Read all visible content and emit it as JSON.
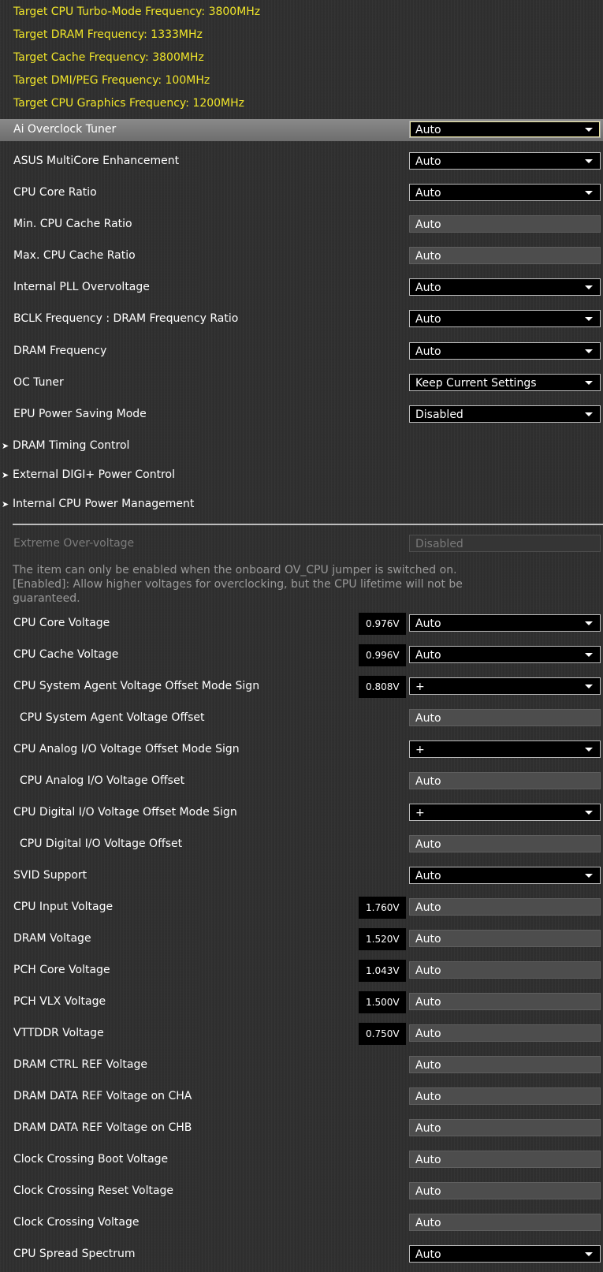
{
  "info_lines": [
    "Target CPU Turbo-Mode Frequency: 3800MHz",
    "Target DRAM Frequency: 1333MHz",
    "Target Cache Frequency: 3800MHz",
    "Target DMI/PEG Frequency: 100MHz",
    "Target CPU Graphics Frequency: 1200MHz"
  ],
  "settings_a": [
    {
      "label": "Ai Overclock Tuner",
      "value": "Auto",
      "type": "dropdown",
      "selected": true
    },
    {
      "label": "ASUS MultiCore Enhancement",
      "value": "Auto",
      "type": "dropdown"
    },
    {
      "label": "CPU Core Ratio",
      "value": "Auto",
      "type": "dropdown"
    },
    {
      "label": "Min. CPU Cache Ratio",
      "value": "Auto",
      "type": "textbox"
    },
    {
      "label": "Max. CPU Cache Ratio",
      "value": "Auto",
      "type": "textbox"
    },
    {
      "label": "Internal PLL Overvoltage",
      "value": "Auto",
      "type": "dropdown"
    },
    {
      "label": "BCLK Frequency : DRAM Frequency Ratio",
      "value": "Auto",
      "type": "dropdown"
    },
    {
      "label": "DRAM Frequency",
      "value": "Auto",
      "type": "dropdown"
    },
    {
      "label": "OC Tuner",
      "value": "Keep Current Settings",
      "type": "dropdown"
    },
    {
      "label": "EPU Power Saving Mode",
      "value": "Disabled",
      "type": "dropdown"
    }
  ],
  "submenus": [
    {
      "label": "DRAM Timing Control"
    },
    {
      "label": "External DIGI+ Power Control"
    },
    {
      "label": "Internal CPU Power Management"
    }
  ],
  "extreme_overvoltage": {
    "label": "Extreme Over-voltage",
    "value": "Disabled"
  },
  "help_lines": [
    "The item can only be enabled when the onboard OV_CPU jumper is switched on.",
    "[Enabled]: Allow higher voltages for overclocking, but the CPU lifetime will not be",
    "guaranteed."
  ],
  "settings_b": [
    {
      "label": "CPU Core Voltage",
      "value": "Auto",
      "type": "dropdown",
      "reading": "0.976V"
    },
    {
      "label": "CPU Cache Voltage",
      "value": "Auto",
      "type": "dropdown",
      "reading": "0.996V"
    },
    {
      "label": "CPU System Agent Voltage Offset Mode Sign",
      "value": "+",
      "type": "dropdown",
      "reading": "0.808V"
    },
    {
      "label": "CPU System Agent Voltage Offset",
      "value": "Auto",
      "type": "textbox",
      "indent": true
    },
    {
      "label": "CPU Analog I/O Voltage Offset Mode Sign",
      "value": "+",
      "type": "dropdown"
    },
    {
      "label": "CPU Analog I/O Voltage Offset",
      "value": "Auto",
      "type": "textbox",
      "indent": true
    },
    {
      "label": "CPU Digital I/O Voltage Offset Mode Sign",
      "value": "+",
      "type": "dropdown"
    },
    {
      "label": "CPU Digital I/O Voltage Offset",
      "value": "Auto",
      "type": "textbox",
      "indent": true
    },
    {
      "label": "SVID Support",
      "value": "Auto",
      "type": "dropdown"
    },
    {
      "label": "CPU Input Voltage",
      "value": "Auto",
      "type": "textbox",
      "reading": "1.760V"
    },
    {
      "label": "DRAM Voltage",
      "value": "Auto",
      "type": "textbox",
      "reading": "1.520V"
    },
    {
      "label": "PCH Core Voltage",
      "value": "Auto",
      "type": "textbox",
      "reading": "1.043V"
    },
    {
      "label": "PCH VLX Voltage",
      "value": "Auto",
      "type": "textbox",
      "reading": "1.500V"
    },
    {
      "label": "VTTDDR Voltage",
      "value": "Auto",
      "type": "textbox",
      "reading": "0.750V"
    },
    {
      "label": "DRAM CTRL REF Voltage",
      "value": "Auto",
      "type": "textbox"
    },
    {
      "label": "DRAM DATA REF Voltage on CHA",
      "value": "Auto",
      "type": "textbox"
    },
    {
      "label": "DRAM DATA REF Voltage on CHB",
      "value": "Auto",
      "type": "textbox"
    },
    {
      "label": "Clock Crossing Boot Voltage",
      "value": "Auto",
      "type": "textbox"
    },
    {
      "label": "Clock Crossing Reset Voltage",
      "value": "Auto",
      "type": "textbox"
    },
    {
      "label": "Clock Crossing Voltage",
      "value": "Auto",
      "type": "textbox"
    },
    {
      "label": "CPU Spread Spectrum",
      "value": "Auto",
      "type": "dropdown"
    }
  ],
  "colors": {
    "info_text": "#f0e52a",
    "selected_row": "#7a7a7a",
    "background": "#2f2f2f"
  }
}
